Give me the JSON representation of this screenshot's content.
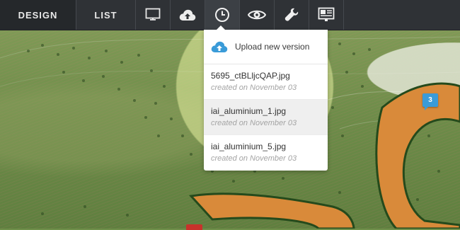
{
  "toolbar": {
    "design_label": "DESIGN",
    "list_label": "LIST",
    "icons": [
      "monitor-icon",
      "cloud-upload-icon",
      "clock-icon",
      "eye-icon",
      "wrench-icon",
      "presentation-icon"
    ],
    "active_icon": "clock-icon"
  },
  "history_dropdown": {
    "upload_label": "Upload new version",
    "versions": [
      {
        "filename": "5695_ctBLljcQAP.jpg",
        "created": "created on November 03"
      },
      {
        "filename": "iai_aluminium_1.jpg",
        "created": "created on November 03"
      },
      {
        "filename": "iai_aluminium_5.jpg",
        "created": "created on November 03"
      }
    ]
  },
  "canvas": {
    "comment_pin_count": "3"
  },
  "colors": {
    "toolbar_bg": "#2f3236",
    "accent_blue": "#3a9bd8",
    "marker_red": "#c8322b"
  }
}
